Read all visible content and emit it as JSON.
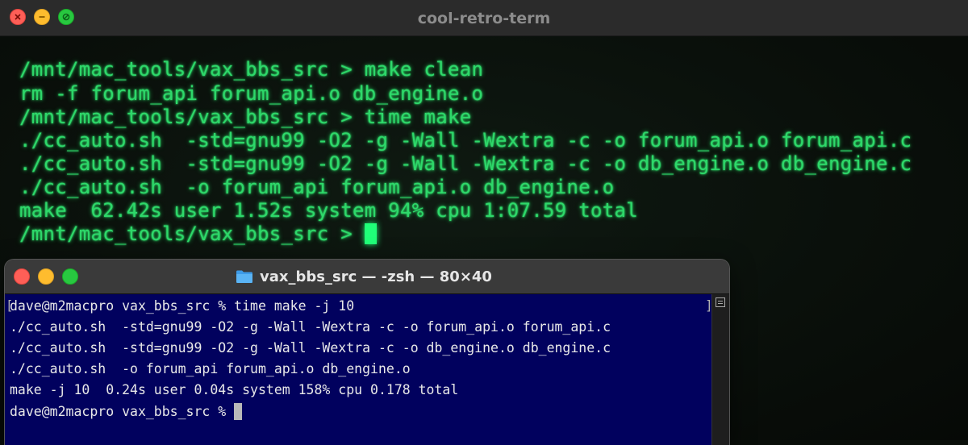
{
  "retro_window": {
    "title": "cool-retro-term",
    "lines": [
      "/mnt/mac_tools/vax_bbs_src > make clean",
      "rm -f forum_api forum_api.o db_engine.o",
      "/mnt/mac_tools/vax_bbs_src > time make",
      "./cc_auto.sh  -std=gnu99 -O2 -g -Wall -Wextra -c -o forum_api.o forum_api.c",
      "./cc_auto.sh  -std=gnu99 -O2 -g -Wall -Wextra -c -o db_engine.o db_engine.c",
      "./cc_auto.sh  -o forum_api forum_api.o db_engine.o",
      "make  62.42s user 1.52s system 94% cpu 1:07.59 total"
    ],
    "prompt": "/mnt/mac_tools/vax_bbs_src > ",
    "text_color": "#2ed86a"
  },
  "terminal_window": {
    "title": "vax_bbs_src — -zsh — 80×40",
    "title_icon": "folder-icon",
    "lines": [
      "dave@m2macpro vax_bbs_src % time make -j 10",
      "./cc_auto.sh  -std=gnu99 -O2 -g -Wall -Wextra -c -o forum_api.o forum_api.c",
      "./cc_auto.sh  -std=gnu99 -O2 -g -Wall -Wextra -c -o db_engine.o db_engine.c",
      "./cc_auto.sh  -o forum_api forum_api.o db_engine.o",
      "make -j 10  0.24s user 0.04s system 158% cpu 0.178 total"
    ],
    "prompt": "dave@m2macpro vax_bbs_src % ",
    "background": "#01015e"
  }
}
